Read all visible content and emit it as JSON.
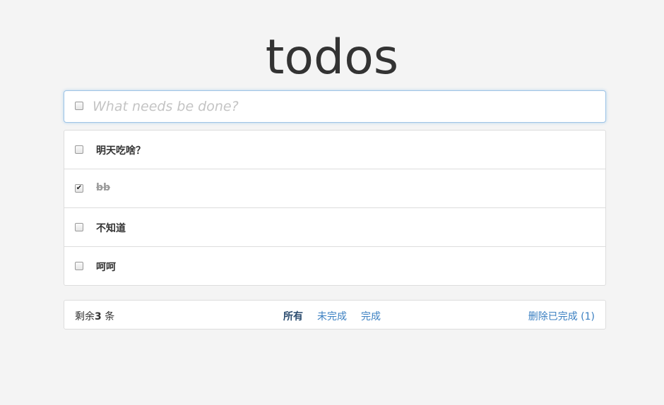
{
  "header": {
    "title": "todos"
  },
  "new_todo": {
    "placeholder": "What needs be done?"
  },
  "todos": [
    {
      "text": "明天吃啥？",
      "completed": false
    },
    {
      "text": "bb",
      "completed": true
    },
    {
      "text": "不知道",
      "completed": false
    },
    {
      "text": "呵呵",
      "completed": false
    }
  ],
  "footer": {
    "count_prefix": "剩余",
    "count_value": "3",
    "count_suffix": " 条",
    "filters": [
      {
        "label": "所有",
        "selected": true
      },
      {
        "label": "未完成",
        "selected": false
      },
      {
        "label": "完成",
        "selected": false
      }
    ],
    "clear_label": "删除已完成 (1)"
  }
}
